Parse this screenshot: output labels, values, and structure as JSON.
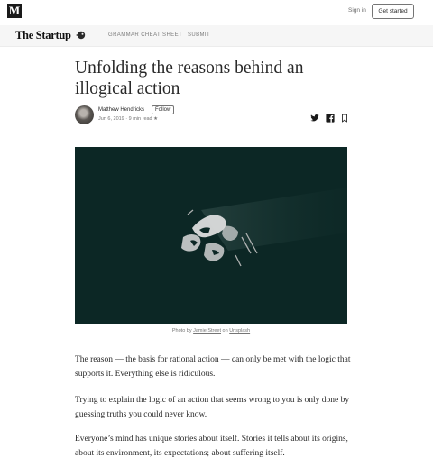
{
  "topbar": {
    "logo_letter": "M",
    "signin_label": "Sign in",
    "get_started_label": "Get started"
  },
  "publication": {
    "name": "The Startup",
    "nav": [
      "GRAMMAR CHEAT SHEET",
      "SUBMIT"
    ]
  },
  "article": {
    "title": "Unfolding the reasons behind an illogical action",
    "author": "Matthew Hendricks",
    "follow_label": "Follow",
    "meta": "Jun 6, 2019 · 9 min read",
    "star": "★",
    "caption": {
      "prefix": "Photo by ",
      "photographer": "Jamie Street",
      "middle": " on ",
      "source": "Unsplash"
    },
    "paragraphs": [
      "The reason — the basis for rational action — can only be met with the logic that supports it. Everything else is ridiculous.",
      "Trying to explain the logic of an action that seems wrong to you is only done by guessing truths you could never know.",
      "Everyone’s mind has unique stories about itself. Stories it tells about its origins, about its environment, its expectations; about suffering itself."
    ]
  },
  "icons": {
    "share_twitter": "twitter-icon",
    "share_facebook": "facebook-icon",
    "bookmark": "bookmark-icon"
  },
  "colors": {
    "hero_background": "#0c2725",
    "text": "#292929",
    "muted": "#757575"
  }
}
